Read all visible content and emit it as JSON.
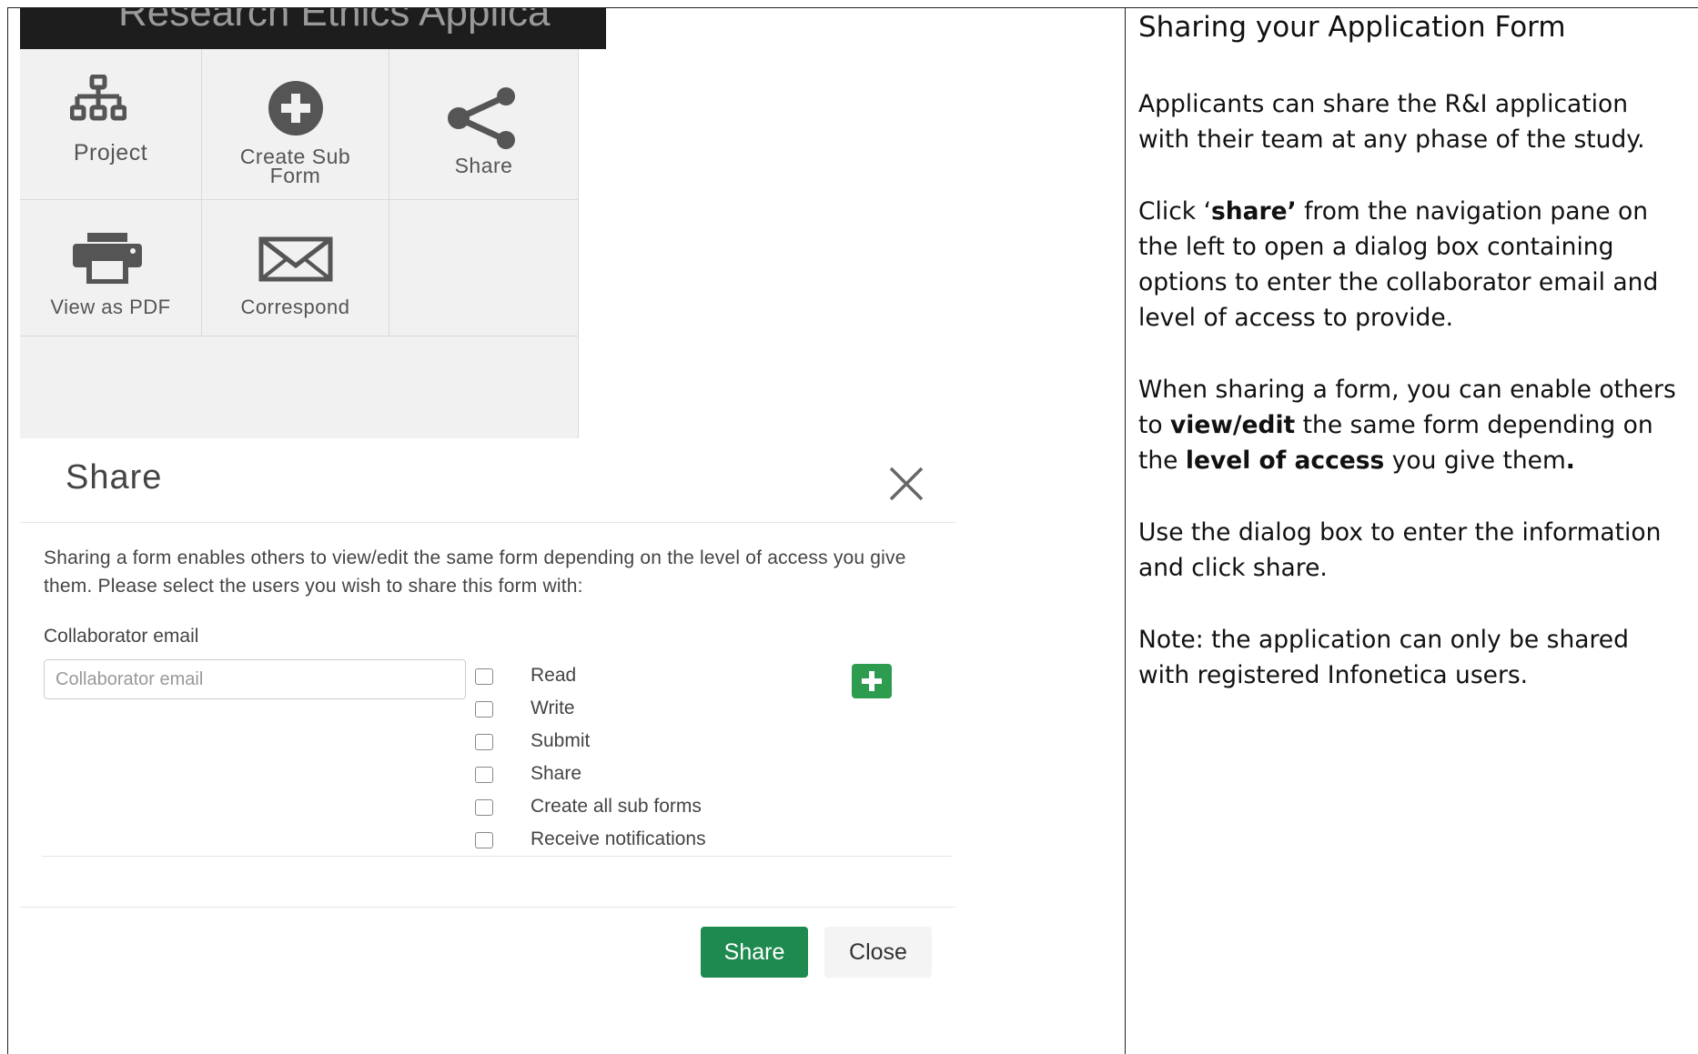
{
  "app": {
    "header_title": "Research Ethics Applica"
  },
  "nav": {
    "tiles": [
      {
        "label": "Project",
        "icon": "org-chart-icon"
      },
      {
        "label": "Create Sub Form",
        "icon": "plus-circle-icon"
      },
      {
        "label": "Share",
        "icon": "share-icon"
      },
      {
        "label": "View as PDF",
        "icon": "printer-icon"
      },
      {
        "label": "Correspond",
        "icon": "envelope-icon"
      }
    ]
  },
  "dialog": {
    "title": "Share",
    "description": "Sharing a form enables others to view/edit the same form depending on the level of access you give them. Please select the users you wish to share this form with:",
    "email_label": "Collaborator email",
    "email_placeholder": "Collaborator email",
    "email_value": "",
    "permissions": [
      "Read",
      "Write",
      "Submit",
      "Share",
      "Create all sub forms",
      "Receive notifications"
    ],
    "share_button": "Share",
    "close_button": "Close",
    "accent_color": "#1f8a4f"
  },
  "help": {
    "heading": "Sharing your Application Form",
    "p1": "Applicants can share the R&I application with their team at any phase of the study.",
    "p2": {
      "pre": "Click ‘",
      "bold": "share’",
      "post": " from the navigation pane on the left to open a dialog box containing options to enter the collaborator email and level of access to provide."
    },
    "p3": {
      "pre": "When sharing a form, you can enable others to ",
      "bold1": "view/edit",
      "mid": " the same form depending on the ",
      "bold2": "level of access",
      "post": " you give them",
      "end": "."
    },
    "p4": "Use the dialog box to enter the information and click share.",
    "p5": "Note: the application can only be shared with registered Infonetica users."
  }
}
